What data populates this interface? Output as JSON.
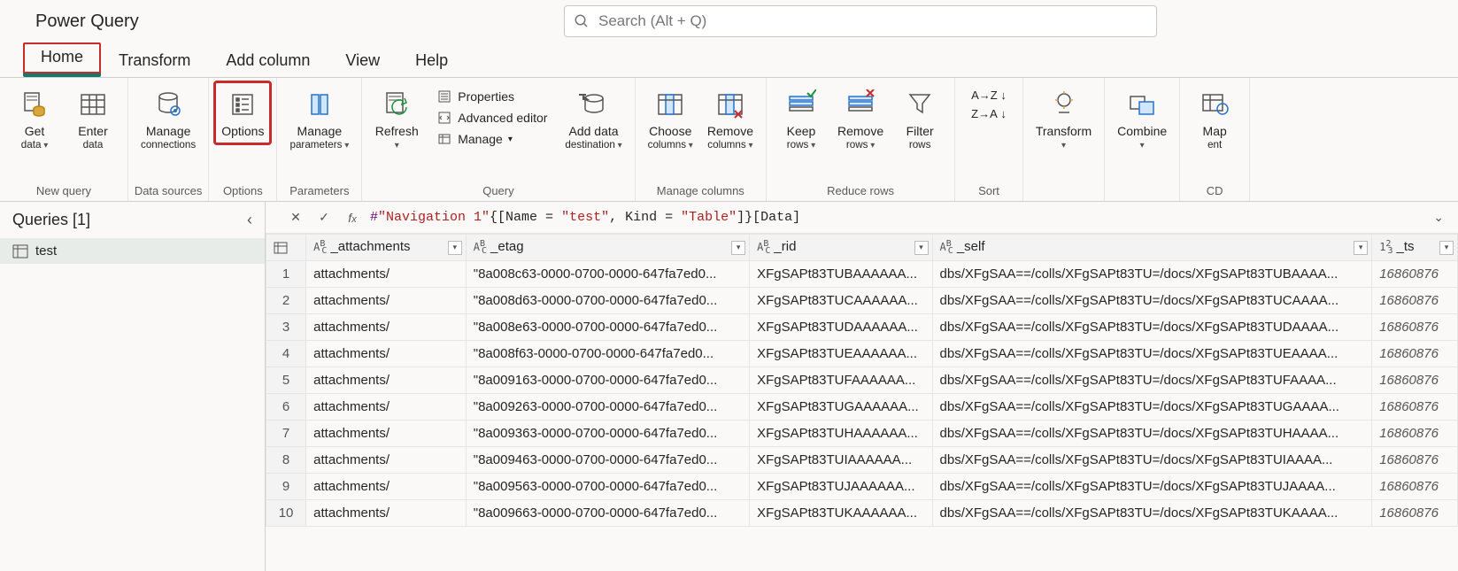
{
  "app_title": "Power Query",
  "search_placeholder": "Search (Alt + Q)",
  "tabs": [
    "Home",
    "Transform",
    "Add column",
    "View",
    "Help"
  ],
  "active_tab": 0,
  "ribbon": {
    "groups": [
      {
        "label": "New query",
        "items": [
          {
            "name": "get-data",
            "label1": "Get",
            "label2": "data",
            "drop": true
          },
          {
            "name": "enter-data",
            "label1": "Enter",
            "label2": "data"
          }
        ]
      },
      {
        "label": "Data sources",
        "items": [
          {
            "name": "manage-connections",
            "label1": "Manage",
            "label2": "connections"
          }
        ]
      },
      {
        "label": "Options",
        "items": [
          {
            "name": "options",
            "label1": "Options",
            "label2": ""
          }
        ],
        "highlight": true
      },
      {
        "label": "Parameters",
        "items": [
          {
            "name": "manage-parameters",
            "label1": "Manage",
            "label2": "parameters",
            "drop": true
          }
        ]
      },
      {
        "label": "Query",
        "big": [
          {
            "name": "refresh",
            "label1": "Refresh",
            "label2": "",
            "drop": true
          }
        ],
        "mini": [
          {
            "name": "properties",
            "label": "Properties"
          },
          {
            "name": "advanced-editor",
            "label": "Advanced editor"
          },
          {
            "name": "manage",
            "label": "Manage",
            "drop": true
          }
        ],
        "big2": [
          {
            "name": "add-data-destination",
            "label1": "Add data",
            "label2": "destination",
            "drop": true
          }
        ]
      },
      {
        "label": "Manage columns",
        "items": [
          {
            "name": "choose-columns",
            "label1": "Choose",
            "label2": "columns",
            "drop": true
          },
          {
            "name": "remove-columns",
            "label1": "Remove",
            "label2": "columns",
            "drop": true
          }
        ]
      },
      {
        "label": "Reduce rows",
        "items": [
          {
            "name": "keep-rows",
            "label1": "Keep",
            "label2": "rows",
            "drop": true
          },
          {
            "name": "remove-rows",
            "label1": "Remove",
            "label2": "rows",
            "drop": true
          },
          {
            "name": "filter-rows",
            "label1": "Filter",
            "label2": "rows"
          }
        ]
      },
      {
        "label": "Sort",
        "sort": true
      },
      {
        "label": "",
        "items": [
          {
            "name": "transform",
            "label1": "Transform",
            "label2": "",
            "drop": true
          }
        ]
      },
      {
        "label": "",
        "items": [
          {
            "name": "combine",
            "label1": "Combine",
            "label2": "",
            "drop": true
          }
        ]
      },
      {
        "label": "CD",
        "items": [
          {
            "name": "map-entity",
            "label1": "Map",
            "label2": "ent"
          }
        ]
      }
    ]
  },
  "queries": {
    "title": "Queries [1]",
    "items": [
      {
        "name": "test"
      }
    ]
  },
  "formula": {
    "prefix": "#",
    "nav": "\"Navigation 1\"",
    "mid1": "{[Name = ",
    "v1": "\"test\"",
    "mid2": ", Kind = ",
    "v2": "\"Table\"",
    "suffix": "]}[Data]"
  },
  "columns": [
    {
      "type": "ABC",
      "name": "_attachments"
    },
    {
      "type": "ABC",
      "name": "_etag"
    },
    {
      "type": "ABC",
      "name": "_rid"
    },
    {
      "type": "ABC",
      "name": "_self"
    },
    {
      "type": "123",
      "name": "_ts"
    }
  ],
  "rows": [
    {
      "att": "attachments/",
      "etag": "\"8a008c63-0000-0700-0000-647fa7ed0...",
      "rid": "XFgSAPt83TUBAAAAAA...",
      "self": "dbs/XFgSAA==/colls/XFgSAPt83TU=/docs/XFgSAPt83TUBAAAA...",
      "ts": "16860876"
    },
    {
      "att": "attachments/",
      "etag": "\"8a008d63-0000-0700-0000-647fa7ed0...",
      "rid": "XFgSAPt83TUCAAAAAA...",
      "self": "dbs/XFgSAA==/colls/XFgSAPt83TU=/docs/XFgSAPt83TUCAAAA...",
      "ts": "16860876"
    },
    {
      "att": "attachments/",
      "etag": "\"8a008e63-0000-0700-0000-647fa7ed0...",
      "rid": "XFgSAPt83TUDAAAAAA...",
      "self": "dbs/XFgSAA==/colls/XFgSAPt83TU=/docs/XFgSAPt83TUDAAAA...",
      "ts": "16860876"
    },
    {
      "att": "attachments/",
      "etag": "\"8a008f63-0000-0700-0000-647fa7ed0...",
      "rid": "XFgSAPt83TUEAAAAAA...",
      "self": "dbs/XFgSAA==/colls/XFgSAPt83TU=/docs/XFgSAPt83TUEAAAA...",
      "ts": "16860876"
    },
    {
      "att": "attachments/",
      "etag": "\"8a009163-0000-0700-0000-647fa7ed0...",
      "rid": "XFgSAPt83TUFAAAAAA...",
      "self": "dbs/XFgSAA==/colls/XFgSAPt83TU=/docs/XFgSAPt83TUFAAAA...",
      "ts": "16860876"
    },
    {
      "att": "attachments/",
      "etag": "\"8a009263-0000-0700-0000-647fa7ed0...",
      "rid": "XFgSAPt83TUGAAAAAA...",
      "self": "dbs/XFgSAA==/colls/XFgSAPt83TU=/docs/XFgSAPt83TUGAAAA...",
      "ts": "16860876"
    },
    {
      "att": "attachments/",
      "etag": "\"8a009363-0000-0700-0000-647fa7ed0...",
      "rid": "XFgSAPt83TUHAAAAAA...",
      "self": "dbs/XFgSAA==/colls/XFgSAPt83TU=/docs/XFgSAPt83TUHAAAA...",
      "ts": "16860876"
    },
    {
      "att": "attachments/",
      "etag": "\"8a009463-0000-0700-0000-647fa7ed0...",
      "rid": "XFgSAPt83TUIAAAAAA...",
      "self": "dbs/XFgSAA==/colls/XFgSAPt83TU=/docs/XFgSAPt83TUIAAAA...",
      "ts": "16860876"
    },
    {
      "att": "attachments/",
      "etag": "\"8a009563-0000-0700-0000-647fa7ed0...",
      "rid": "XFgSAPt83TUJAAAAAA...",
      "self": "dbs/XFgSAA==/colls/XFgSAPt83TU=/docs/XFgSAPt83TUJAAAA...",
      "ts": "16860876"
    },
    {
      "att": "attachments/",
      "etag": "\"8a009663-0000-0700-0000-647fa7ed0...",
      "rid": "XFgSAPt83TUKAAAAAA...",
      "self": "dbs/XFgSAA==/colls/XFgSAPt83TU=/docs/XFgSAPt83TUKAAAA...",
      "ts": "16860876"
    }
  ]
}
